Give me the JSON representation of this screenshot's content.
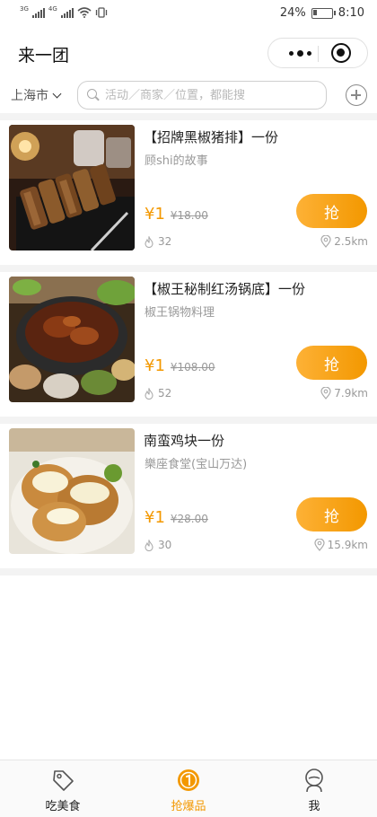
{
  "status_bar": {
    "net_left": "3G",
    "net_right": "4G",
    "battery": "24%",
    "battery_level": 0.24,
    "time": "8:10"
  },
  "header": {
    "title": "来一团"
  },
  "search": {
    "city": "上海市",
    "placeholder": "活动／商家／位置，都能搜"
  },
  "colors": {
    "accent": "#f39800",
    "accent_light": "#fdb136",
    "muted": "#999999"
  },
  "deals": [
    {
      "title": "【招牌黑椒猪排】一份",
      "shop": "顾shi的故事",
      "price": "¥1",
      "original_price": "¥18.00",
      "button": "抢",
      "hot_count": "32",
      "distance": "2.5km"
    },
    {
      "title": "【椒王秘制红汤锅底】一份",
      "shop": "椒王锅物料理",
      "price": "¥1",
      "original_price": "¥108.00",
      "button": "抢",
      "hot_count": "52",
      "distance": "7.9km"
    },
    {
      "title": "南蛮鸡块一份",
      "shop": "樂座食堂(宝山万达)",
      "price": "¥1",
      "original_price": "¥28.00",
      "button": "抢",
      "hot_count": "30",
      "distance": "15.9km"
    }
  ],
  "tabs": [
    {
      "label": "吃美食",
      "icon": "tag-icon",
      "active": false
    },
    {
      "label": "抢爆品",
      "icon": "coin-icon",
      "active": true
    },
    {
      "label": "我",
      "icon": "person-icon",
      "active": false
    }
  ]
}
